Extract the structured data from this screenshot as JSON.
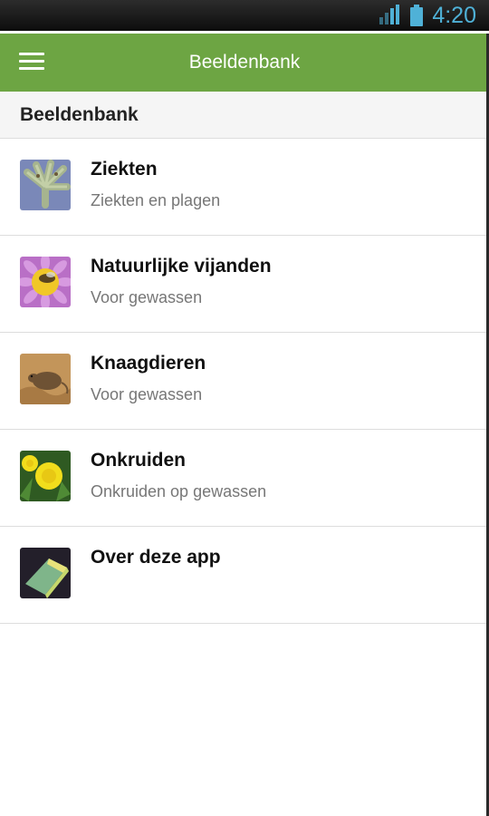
{
  "status_bar": {
    "time": "4:20",
    "signal_icon": "signal-icon",
    "battery_icon": "battery-icon"
  },
  "app_bar": {
    "title": "Beeldenbank",
    "menu_icon": "hamburger-menu-icon"
  },
  "section": {
    "title": "Beeldenbank"
  },
  "items": [
    {
      "title": "Ziekten",
      "subtitle": "Ziekten en plagen",
      "icon": "leaf-disease-icon"
    },
    {
      "title": "Natuurlijke vijanden",
      "subtitle": "Voor gewassen",
      "icon": "bee-on-flower-icon"
    },
    {
      "title": "Knaagdieren",
      "subtitle": "Voor gewassen",
      "icon": "rodent-icon"
    },
    {
      "title": "Onkruiden",
      "subtitle": "Onkruiden op gewassen",
      "icon": "dandelion-icon"
    },
    {
      "title": "Over deze app",
      "subtitle": "",
      "icon": "app-logo-icon"
    }
  ],
  "colors": {
    "app_bar": "#6da543",
    "status_accent": "#4fb1d7",
    "status_bar": "#1a1a1a"
  }
}
